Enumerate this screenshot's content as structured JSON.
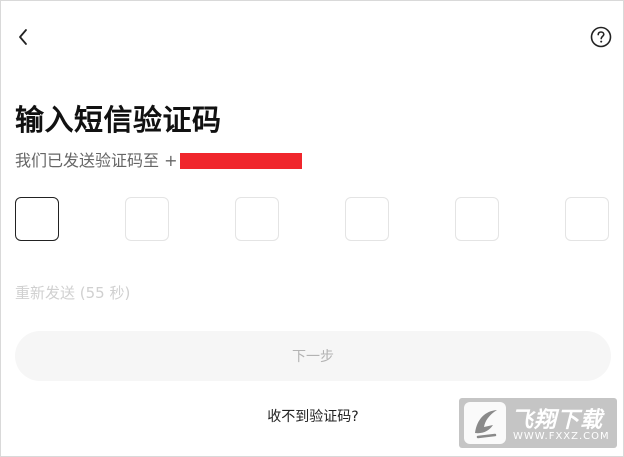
{
  "header": {
    "back_icon": "chevron-left-icon",
    "help_icon": "question-circle-icon"
  },
  "page": {
    "title": "输入短信验证码",
    "subtitle_prefix": "我们已发送验证码至 +"
  },
  "code_inputs": {
    "count": 6,
    "values": [
      "",
      "",
      "",
      "",
      "",
      ""
    ],
    "active_index": 0
  },
  "resend": {
    "label": "重新发送 (55 秒)"
  },
  "actions": {
    "next_label": "下一步",
    "no_code_label": "收不到验证码?"
  },
  "watermark": {
    "brand": "飞翔下载",
    "url": "WWW.FXXZ.COM"
  },
  "colors": {
    "redaction": "#f0262c",
    "text_primary": "#111111",
    "text_secondary": "#666666",
    "text_disabled": "#d0d0d0",
    "button_bg": "#f6f6f6"
  }
}
